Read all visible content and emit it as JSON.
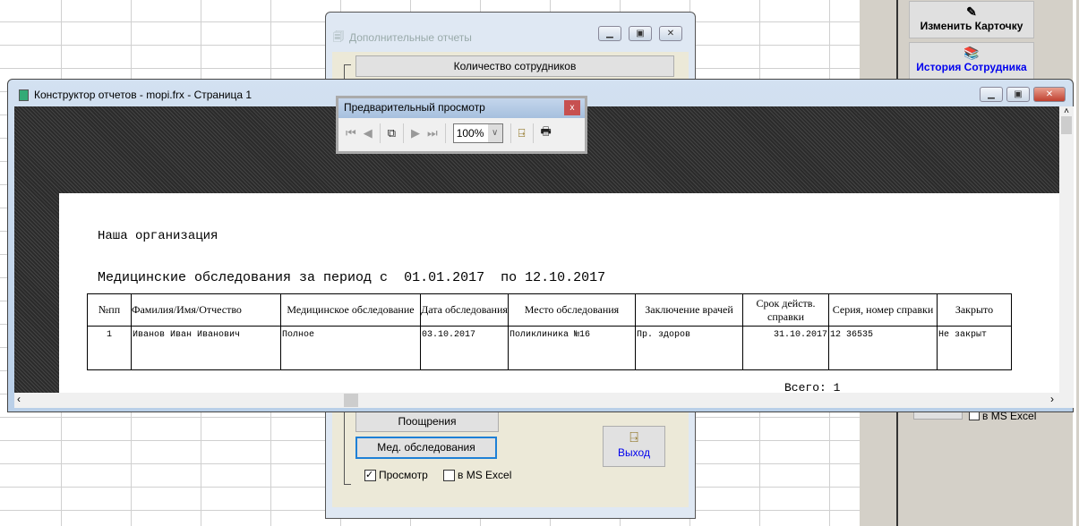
{
  "right_panel": {
    "edit_card": "Изменить Карточку",
    "history": "История Сотрудника",
    "excel_check": "в MS Excel"
  },
  "reports_dialog": {
    "title": "Дополнительные отчеты",
    "btn_employees": "Количество сотрудников",
    "btn_rewards": "Поощрения",
    "btn_medical": "Мед. обследования",
    "preview_label": "Просмотр",
    "preview_checked": true,
    "excel_label": "в MS Excel",
    "excel_checked": false,
    "exit_label": "Выход"
  },
  "main_window": {
    "title": "Конструктор отчетов - mopi.frx - Страница 1"
  },
  "toolbar": {
    "title": "Предварительный просмотр",
    "zoom": "100%"
  },
  "report": {
    "org": "Наша организация",
    "heading": "Медицинские обследования за период с",
    "date_from": "01.01.2017",
    "to_label": "по",
    "date_to": "12.10.2017",
    "columns": [
      "№пп",
      "Фамилия/Имя/Отчество",
      "Медицинское обследование",
      "Дата обследования",
      "Место обследования",
      "Заключение врачей",
      "Срок действ. справки",
      "Серия, номер справки",
      "Закрыто"
    ],
    "rows": [
      [
        "1",
        "Иванов Иван Иванович",
        "Полное",
        "03.10.2017",
        "Поликлиника №16",
        "Пр. здоров",
        "31.10.2017",
        "12 36535",
        "Не закрыт"
      ]
    ],
    "total_label": "Всего:",
    "total": "1"
  }
}
